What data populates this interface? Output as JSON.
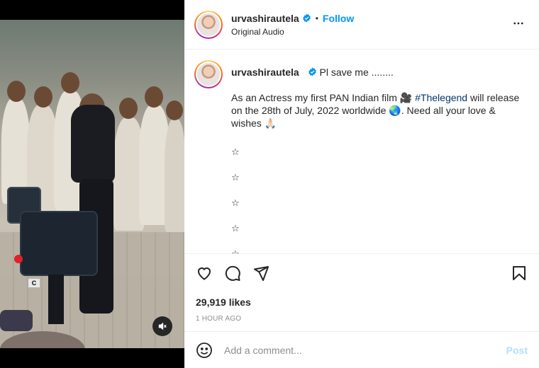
{
  "header": {
    "username": "urvashirautela",
    "separator": "•",
    "follow_label": "Follow",
    "subtitle": "Original Audio"
  },
  "caption": {
    "username": "urvashirautela",
    "first_line": "Pl save me ........",
    "body_before_hashtag": "As an Actress my first PAN Indian film 🎥 ",
    "hashtag": "#Thelegend",
    "body_after_hashtag": " will release on the 28th of July, 2022 worldwide 🌏. Need all your love & wishes 🙏🏻",
    "stars": [
      "☆",
      "☆",
      "☆",
      "☆",
      "☆"
    ]
  },
  "actions": {
    "likes": "29,919 likes",
    "time": "1 HOUR AGO"
  },
  "comment": {
    "placeholder": "Add a comment...",
    "post_label": "Post"
  },
  "icons": {
    "verified": "verified-badge-icon",
    "more": "more-options-icon",
    "like": "heart-icon",
    "comment": "comment-icon",
    "share": "share-icon",
    "save": "bookmark-icon",
    "emoji": "emoji-icon",
    "mute": "muted-speaker-icon"
  },
  "colors": {
    "accent": "#0095f6",
    "hashtag": "#00376b",
    "post_disabled": "#b2dffc",
    "muted_text": "#8e8e8e"
  }
}
